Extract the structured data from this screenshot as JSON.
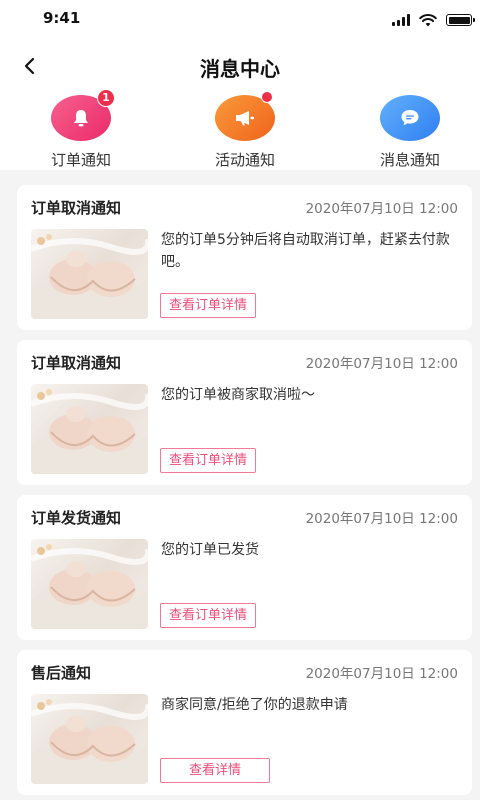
{
  "status_bar": {
    "time": "9:41"
  },
  "header": {
    "title": "消息中心"
  },
  "categories": [
    {
      "label": "订单通知",
      "badge": "1",
      "icon": "bell-icon",
      "color": "#f0407a"
    },
    {
      "label": "活动通知",
      "badge": "",
      "icon": "megaphone-icon",
      "color": "#f37324"
    },
    {
      "label": "消息通知",
      "badge": "",
      "icon": "chat-bubble-icon",
      "color": "#3f8ff5"
    }
  ],
  "notifications": [
    {
      "title": "订单取消通知",
      "time": "2020年07月10日 12:00",
      "message": "您的订单5分钟后将自动取消订单，赶紧去付款吧。",
      "button": "查看订单详情"
    },
    {
      "title": "订单取消通知",
      "time": "2020年07月10日 12:00",
      "message": "您的订单被商家取消啦～",
      "button": "查看订单详情"
    },
    {
      "title": "订单发货通知",
      "time": "2020年07月10日 12:00",
      "message": "您的订单已发货",
      "button": "查看订单详情"
    },
    {
      "title": "售后通知",
      "time": "2020年07月10日 12:00",
      "message": "商家同意/拒绝了你的退款申请",
      "button": "查看详情"
    }
  ],
  "colors": {
    "accent": "#ee4e79",
    "badge": "#ef2e49",
    "background": "#f4f4f4"
  }
}
